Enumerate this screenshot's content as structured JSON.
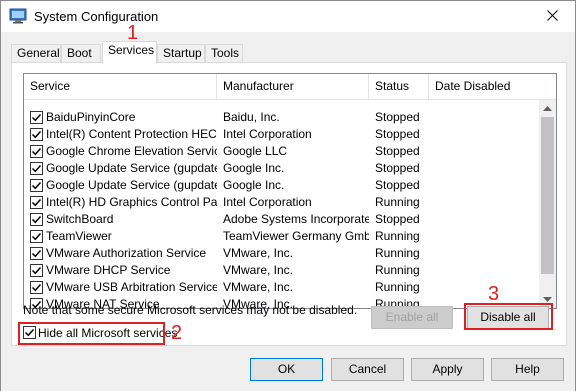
{
  "window": {
    "title": "System Configuration"
  },
  "tabs": [
    {
      "label": "General",
      "active": false
    },
    {
      "label": "Boot",
      "active": false
    },
    {
      "label": "Services",
      "active": true
    },
    {
      "label": "Startup",
      "active": false
    },
    {
      "label": "Tools",
      "active": false
    }
  ],
  "columns": [
    "Service",
    "Manufacturer",
    "Status",
    "Date Disabled"
  ],
  "rows": [
    {
      "service": "BaiduPinyinCore",
      "manufacturer": "Baidu, Inc.",
      "status": "Stopped",
      "checked": true
    },
    {
      "service": "Intel(R) Content Protection HEC...",
      "manufacturer": "Intel Corporation",
      "status": "Stopped",
      "checked": true
    },
    {
      "service": "Google Chrome Elevation Servic...",
      "manufacturer": "Google LLC",
      "status": "Stopped",
      "checked": true
    },
    {
      "service": "Google Update Service (gupdate)",
      "manufacturer": "Google Inc.",
      "status": "Stopped",
      "checked": true
    },
    {
      "service": "Google Update Service (gupdatem)",
      "manufacturer": "Google Inc.",
      "status": "Stopped",
      "checked": true
    },
    {
      "service": "Intel(R) HD Graphics Control Pa...",
      "manufacturer": "Intel Corporation",
      "status": "Running",
      "checked": true
    },
    {
      "service": "SwitchBoard",
      "manufacturer": "Adobe Systems Incorporated",
      "status": "Stopped",
      "checked": true
    },
    {
      "service": "TeamViewer",
      "manufacturer": "TeamViewer Germany GmbH",
      "status": "Running",
      "checked": true
    },
    {
      "service": "VMware Authorization Service",
      "manufacturer": "VMware, Inc.",
      "status": "Running",
      "checked": true
    },
    {
      "service": "VMware DHCP Service",
      "manufacturer": "VMware, Inc.",
      "status": "Running",
      "checked": true
    },
    {
      "service": "VMware USB Arbitration Service",
      "manufacturer": "VMware, Inc.",
      "status": "Running",
      "checked": true
    },
    {
      "service": "VMware NAT Service",
      "manufacturer": "VMware, Inc.",
      "status": "Running",
      "checked": true
    }
  ],
  "note": "Note that some secure Microsoft services may not be disabled.",
  "enable_all": {
    "label": "Enable all",
    "disabled": true
  },
  "disable_all": {
    "label": "Disable all"
  },
  "hide_ms": {
    "label": "Hide all Microsoft services",
    "checked": true
  },
  "buttons": {
    "ok": "OK",
    "cancel": "Cancel",
    "apply": "Apply",
    "help": "Help"
  },
  "annotations": {
    "n1": "1",
    "n2": "2",
    "n3": "3",
    "color": "#e02020"
  }
}
